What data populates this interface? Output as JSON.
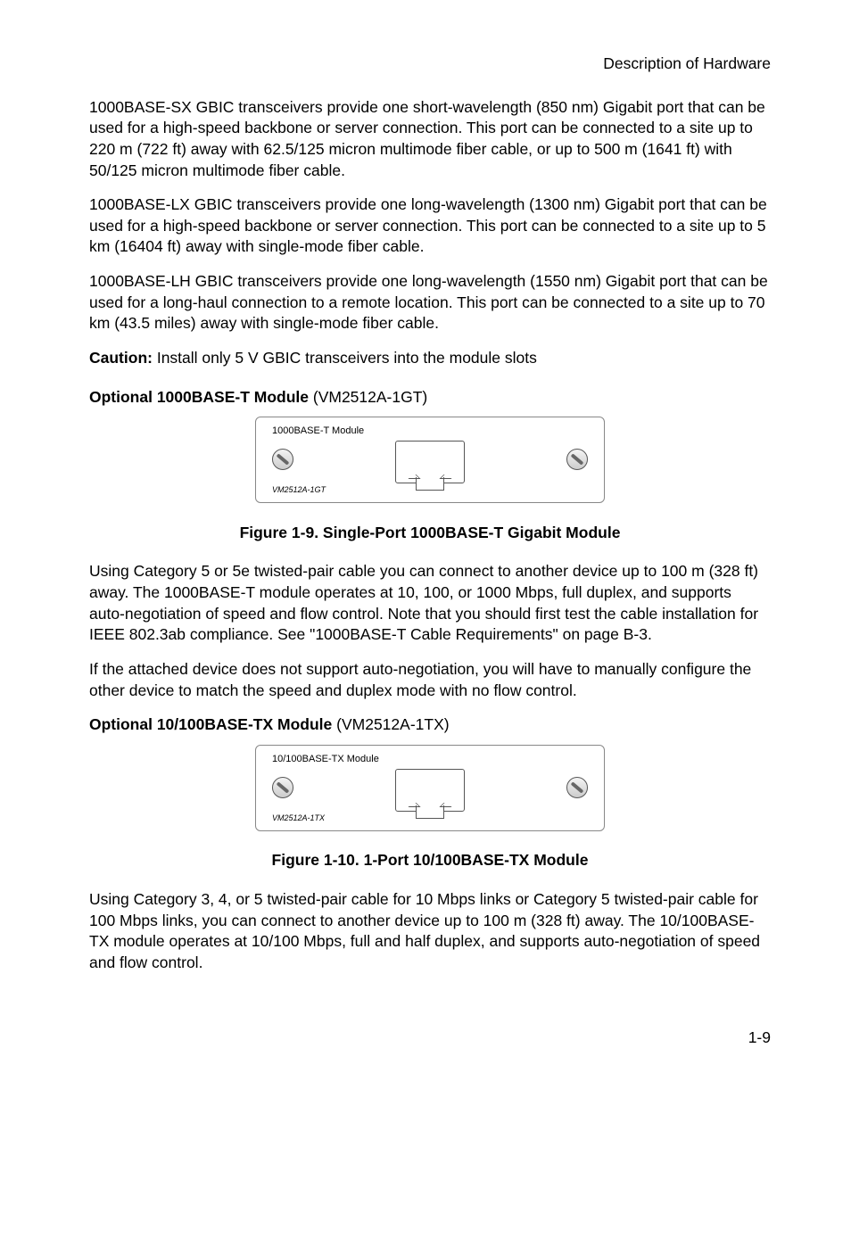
{
  "header": "Description of Hardware",
  "paragraphs": {
    "p1": "1000BASE-SX GBIC transceivers provide one short-wavelength (850 nm) Gigabit port that can be used for a high-speed backbone or server connection. This port can be connected to a site up to 220 m (722 ft) away with 62.5/125 micron multimode fiber cable, or up to 500 m (1641 ft) with 50/125 micron multimode fiber cable.",
    "p2": "1000BASE-LX GBIC transceivers provide one long-wavelength (1300 nm) Gigabit port that can be used for a high-speed backbone or server connection. This port can be connected to a site up to 5 km (16404 ft) away with single-mode fiber cable.",
    "p3": "1000BASE-LH GBIC transceivers provide one long-wavelength (1550 nm) Gigabit port that can be used for a long-haul connection to a remote location. This port can be connected to a site up to 70 km (43.5 miles) away with single-mode fiber cable.",
    "caution_label": "Caution:",
    "caution_text": " Install only 5 V GBIC transceivers into the module slots",
    "opt1_title": "Optional 1000BASE-T Module",
    "opt1_suffix": " (VM2512A-1GT)",
    "module1_label": "1000BASE-T Module",
    "module1_partno": "VM2512A-1GT",
    "fig1_caption": "Figure 1-9.  Single-Port 1000BASE-T Gigabit Module",
    "p4": "Using Category 5 or 5e twisted-pair cable you can connect to another device up to 100 m (328 ft) away. The 1000BASE-T module operates at 10, 100, or 1000 Mbps, full duplex, and supports auto-negotiation of speed and flow control. Note that you should first test the cable installation for IEEE 802.3ab compliance. See \"1000BASE-T Cable Requirements\" on page B-3.",
    "p5": "If the attached device does not support auto-negotiation, you will have to manually configure the other device to match the speed and duplex mode with no flow control.",
    "opt2_title": "Optional 10/100BASE-TX Module",
    "opt2_suffix": " (VM2512A-1TX)",
    "module2_label": "10/100BASE-TX Module",
    "module2_partno": "VM2512A-1TX",
    "fig2_caption": "Figure 1-10.  1-Port 10/100BASE-TX Module",
    "p6": "Using Category 3, 4, or 5 twisted-pair cable for 10 Mbps links or Category 5 twisted-pair cable for 100 Mbps links, you can connect to another device up to 100 m (328 ft) away. The 10/100BASE-TX module operates at 10/100 Mbps, full and half duplex, and supports auto-negotiation of speed and flow control."
  },
  "page_number": "1-9"
}
